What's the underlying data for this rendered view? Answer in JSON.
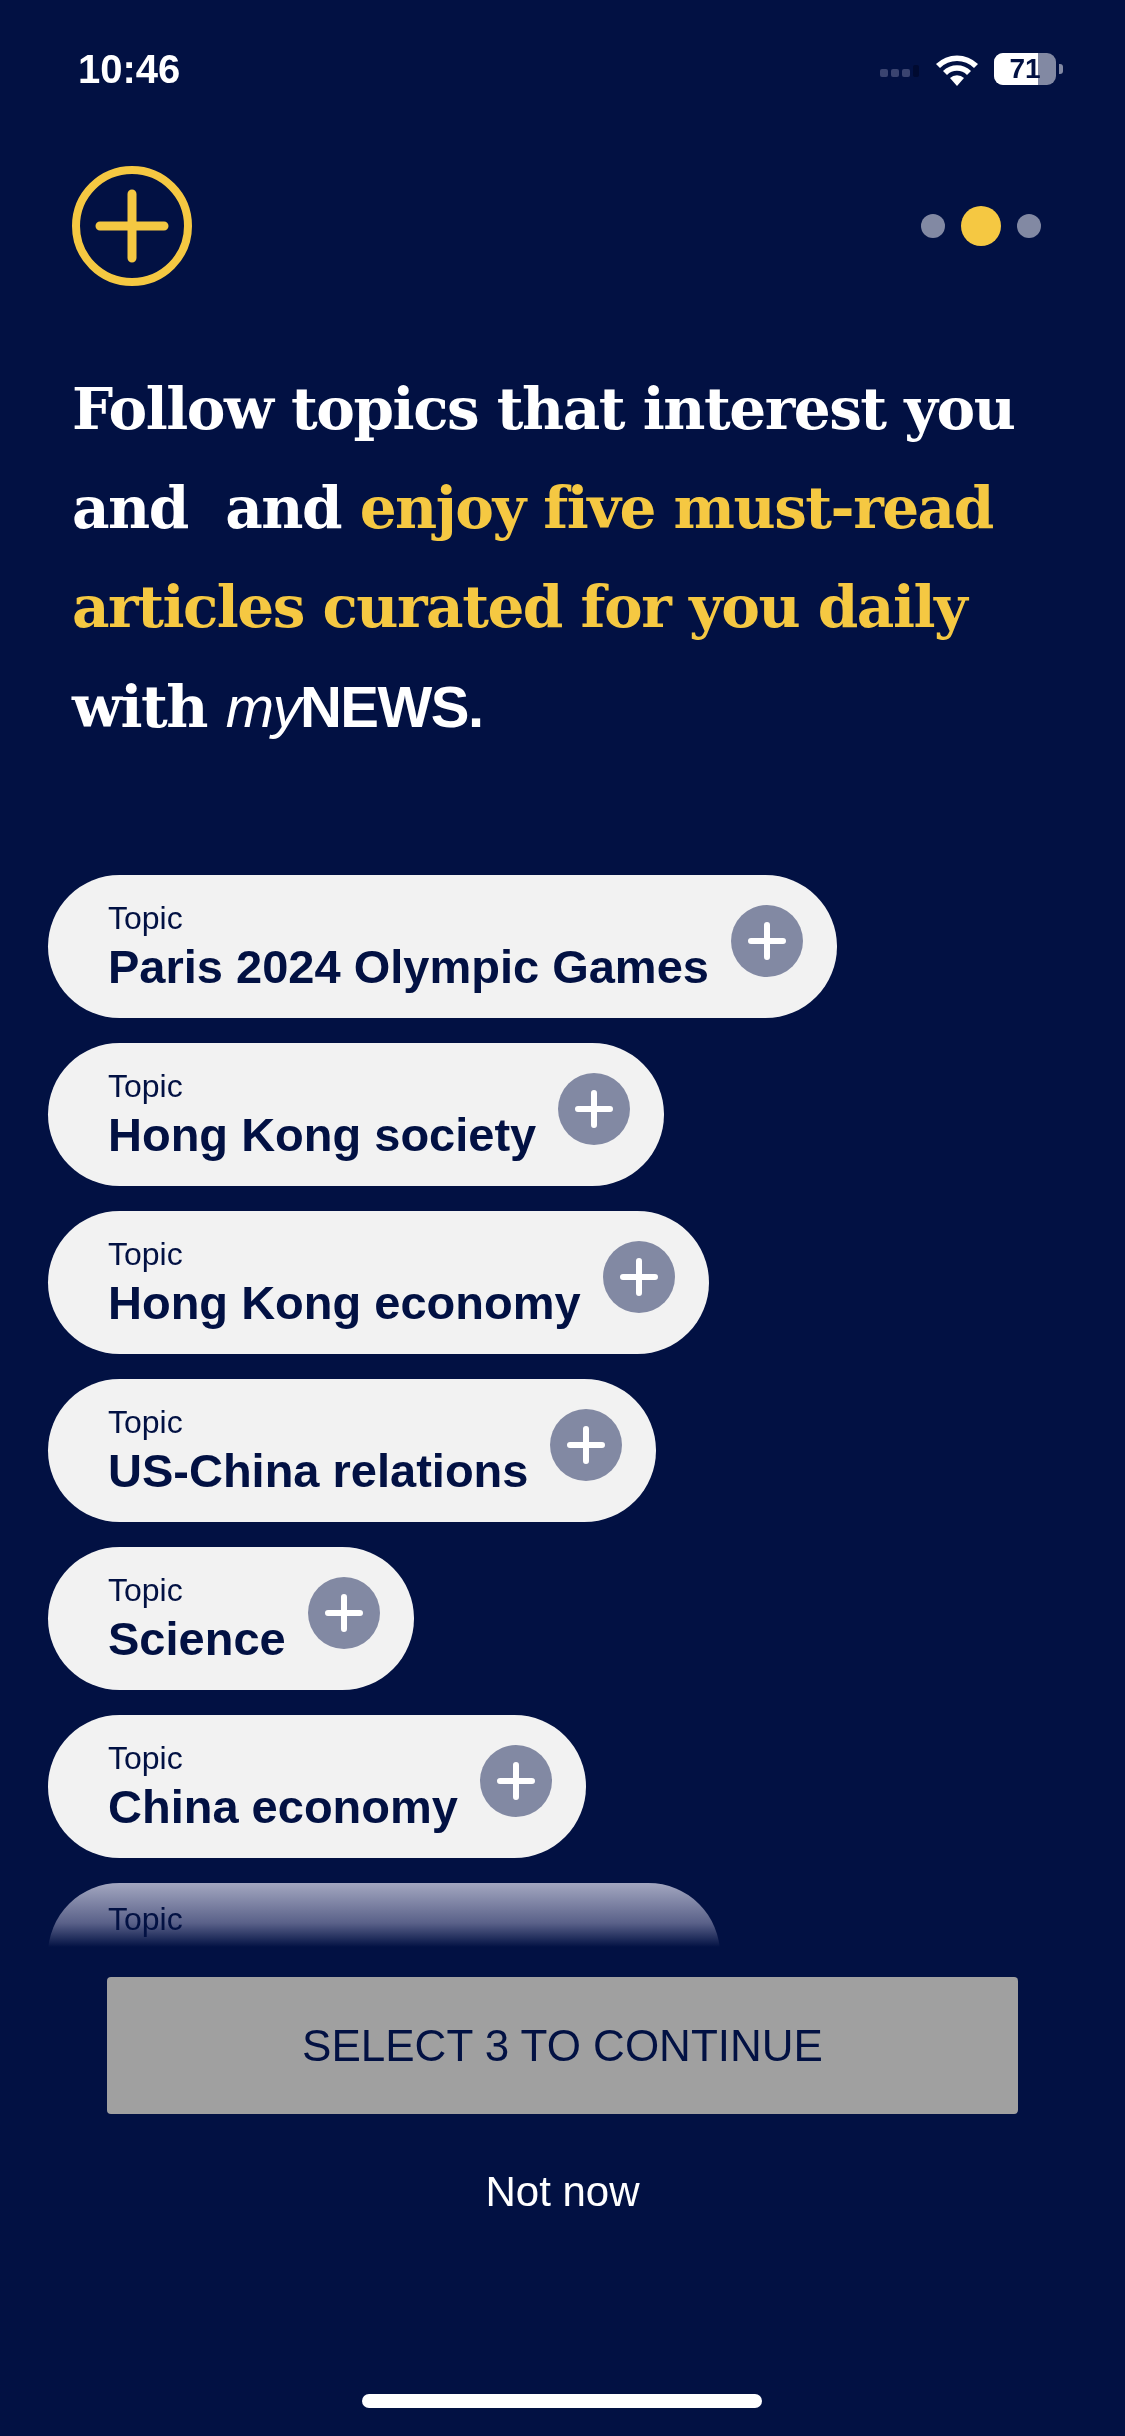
{
  "status_bar": {
    "time": "10:46",
    "battery": "71"
  },
  "pager": [
    {
      "selected": false
    },
    {
      "selected": true
    },
    {
      "selected": false
    }
  ],
  "headline": [
    {
      "text": "Follow topics that interest you and  and ",
      "kind": "plain"
    },
    {
      "text": "enjoy five must-read articles curated for you daily",
      "kind": "highlight"
    },
    {
      "text": " with ",
      "kind": "plain"
    },
    {
      "text": "my",
      "kind": "brand_italic"
    },
    {
      "text": "NEWS.",
      "kind": "brand"
    }
  ],
  "topics": [
    {
      "label": "Topic",
      "title": "Paris 2024 Olympic Games",
      "selected": false
    },
    {
      "label": "Topic",
      "title": "Hong Kong society",
      "selected": false
    },
    {
      "label": "Topic",
      "title": "Hong Kong economy",
      "selected": false
    },
    {
      "label": "Topic",
      "title": "US-China relations",
      "selected": false
    },
    {
      "label": "Topic",
      "title": "Science",
      "selected": false
    },
    {
      "label": "Topic",
      "title": "China economy",
      "selected": false
    }
  ],
  "faded_topic": {
    "label": "Topic"
  },
  "continue_button": {
    "label": "SELECT 3 TO CONTINUE",
    "disabled": true
  },
  "skip_link": "Not now"
}
